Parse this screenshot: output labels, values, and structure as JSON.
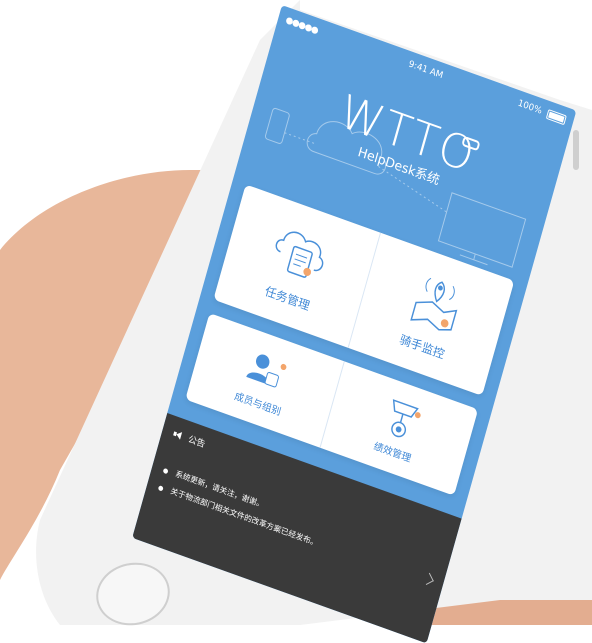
{
  "status": {
    "signal": "●●●●● ",
    "wifi_icon": "wifi-icon",
    "time": "9:41 AM",
    "battery": "100%"
  },
  "brand": {
    "logo": "WTTO",
    "subtitle": "HelpDesk系统"
  },
  "cards": [
    {
      "label": "任务管理",
      "icon": "cloud-document-icon"
    },
    {
      "label": "骑手监控",
      "icon": "map-location-icon"
    },
    {
      "label": "成员与组别",
      "icon": "members-icon"
    },
    {
      "label": "绩效管理",
      "icon": "medal-icon"
    }
  ],
  "notice": {
    "title": "公告",
    "items": [
      "系统更新，请关注，谢谢。",
      "关于物流部门相关文件的改革方案已经发布。"
    ]
  },
  "colors": {
    "screen_bg": "#5b9fdc",
    "card_bg": "#ffffff",
    "accent": "#3f88d6",
    "notice_bg": "#3a3a3a"
  }
}
